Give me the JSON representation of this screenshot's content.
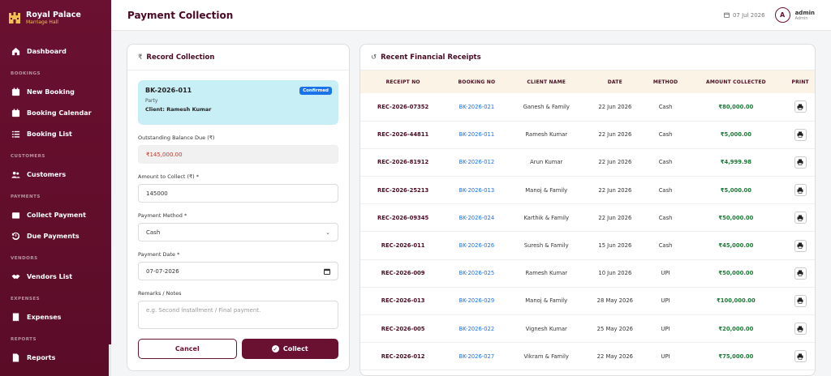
{
  "brand": {
    "name": "Royal Palace",
    "subtitle": "Marriage Hall"
  },
  "sidebar": {
    "dashboard": "Dashboard",
    "sections": {
      "bookings": "BOOKINGS",
      "customers": "CUSTOMERS",
      "payments": "PAYMENTS",
      "vendors": "VENDORS",
      "expenses": "EXPENSES",
      "reports": "REPORTS"
    },
    "items": {
      "new_booking": "New Booking",
      "booking_calendar": "Booking Calendar",
      "booking_list": "Booking List",
      "customers": "Customers",
      "collect_payment": "Collect Payment",
      "due_payments": "Due Payments",
      "vendors_list": "Vendors List",
      "expenses": "Expenses",
      "reports": "Reports"
    }
  },
  "header": {
    "title": "Payment Collection",
    "date": "07 Jul 2026",
    "avatar_initial": "A",
    "user_name": "admin",
    "user_role": "Admin"
  },
  "form": {
    "title": "Record Collection",
    "title_icon": "₹",
    "booking": {
      "id": "BK-2026-011",
      "status": "Confirmed",
      "event_type": "Party",
      "client": "Client: Ramesh Kumar"
    },
    "outstanding_label": "Outstanding Balance Due (₹)",
    "outstanding_value": "₹145,000.00",
    "amount_label": "Amount to Collect (₹) *",
    "amount_value": "145000",
    "method_label": "Payment Method *",
    "method_value": "Cash",
    "date_label": "Payment Date *",
    "date_value": "07-07-2026",
    "remarks_label": "Remarks / Notes",
    "remarks_placeholder": "e.g. Second installment / Final payment.",
    "cancel_label": "Cancel",
    "collect_label": "Collect"
  },
  "receipts": {
    "title": "Recent Financial Receipts",
    "columns": [
      "RECEIPT NO",
      "BOOKING NO",
      "CLIENT NAME",
      "DATE",
      "METHOD",
      "AMOUNT COLLECTED",
      "PRINT"
    ],
    "rows": [
      {
        "receipt": "REC-2026-07352",
        "booking": "BK-2026-021",
        "client": "Ganesh & Family",
        "date": "22 Jun 2026",
        "method": "Cash",
        "amount": "₹80,000.00"
      },
      {
        "receipt": "REC-2026-44811",
        "booking": "BK-2026-011",
        "client": "Ramesh Kumar",
        "date": "22 Jun 2026",
        "method": "Cash",
        "amount": "₹5,000.00"
      },
      {
        "receipt": "REC-2026-81912",
        "booking": "BK-2026-012",
        "client": "Arun Kumar",
        "date": "22 Jun 2026",
        "method": "Cash",
        "amount": "₹4,999.98"
      },
      {
        "receipt": "REC-2026-25213",
        "booking": "BK-2026-013",
        "client": "Manoj & Family",
        "date": "22 Jun 2026",
        "method": "Cash",
        "amount": "₹5,000.00"
      },
      {
        "receipt": "REC-2026-09345",
        "booking": "BK-2026-024",
        "client": "Karthik & Family",
        "date": "22 Jun 2026",
        "method": "Cash",
        "amount": "₹50,000.00"
      },
      {
        "receipt": "REC-2026-011",
        "booking": "BK-2026-026",
        "client": "Suresh & Family",
        "date": "15 Jun 2026",
        "method": "Cash",
        "amount": "₹45,000.00"
      },
      {
        "receipt": "REC-2026-009",
        "booking": "BK-2026-025",
        "client": "Ramesh Kumar",
        "date": "10 Jun 2026",
        "method": "UPI",
        "amount": "₹50,000.00"
      },
      {
        "receipt": "REC-2026-013",
        "booking": "BK-2026-029",
        "client": "Manoj & Family",
        "date": "28 May 2026",
        "method": "UPI",
        "amount": "₹100,000.00"
      },
      {
        "receipt": "REC-2026-005",
        "booking": "BK-2026-022",
        "client": "Vignesh Kumar",
        "date": "25 May 2026",
        "method": "UPI",
        "amount": "₹20,000.00"
      },
      {
        "receipt": "REC-2026-012",
        "booking": "BK-2026-027",
        "client": "Vikram & Family",
        "date": "22 May 2026",
        "method": "UPI",
        "amount": "₹75,000.00"
      }
    ]
  },
  "colors": {
    "primary": "#6a1030",
    "link": "#1a73e8",
    "amount": "#1b7a36",
    "card": "#c8eef6",
    "table_header": "#fbf4e6"
  }
}
